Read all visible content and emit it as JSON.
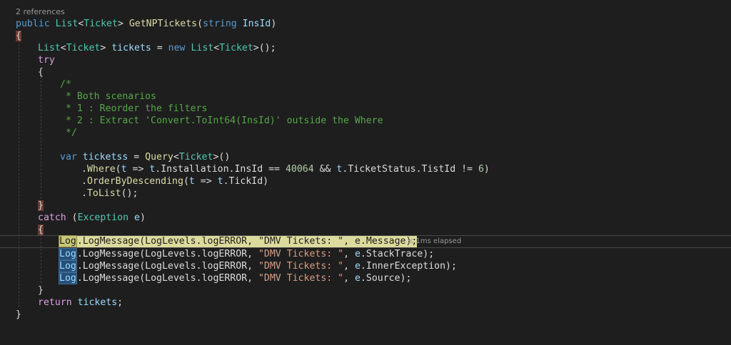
{
  "codelens": "2 references",
  "elapsed": "≤ 1ms elapsed",
  "lines": {
    "sig": {
      "kw1": "public ",
      "ty1": "List",
      "p1": "<",
      "ty2": "Ticket",
      "p2": "> ",
      "fn": "GetNPTickets",
      "p3": "(",
      "kw2": "string",
      "p4": " ",
      "id": "InsId",
      "p5": ")"
    },
    "open1": "{",
    "l3": {
      "ty1": "List",
      "p1": "<",
      "ty2": "Ticket",
      "p2": "> ",
      "id1": "tickets",
      "p3": " = ",
      "kw": "new",
      "p4": " ",
      "ty3": "List",
      "p5": "<",
      "ty4": "Ticket",
      "p6": ">();"
    },
    "try": "try",
    "open2": "{",
    "c1": "/*",
    "c2": " * Both scenarios",
    "c3": " * 1 : Reorder the filters",
    "c4": " * 2 : Extract 'Convert.ToInt64(InsId)' outside the Where",
    "c5": " */",
    "l11": {
      "kw": "var",
      "p1": " ",
      "id": "ticketss",
      "p2": " = ",
      "fn": "Query",
      "p3": "<",
      "ty": "Ticket",
      "p4": ">()"
    },
    "l12": {
      "p1": ".",
      "fn": "Where",
      "p2": "(",
      "id1": "t",
      "p3": " => ",
      "id2": "t",
      "p4": ".",
      "id3": "Installation",
      "p5": ".",
      "id4": "InsId",
      "p6": " == ",
      "num1": "40064",
      "p7": " && ",
      "id5": "t",
      "p8": ".",
      "id6": "TicketStatus",
      "p9": ".",
      "id7": "TistId",
      "p10": " != ",
      "num2": "6",
      "p11": ")"
    },
    "l13": {
      "p1": ".",
      "fn": "OrderByDescending",
      "p2": "(",
      "id1": "t",
      "p3": " => ",
      "id2": "t",
      "p4": ".",
      "id3": "TickId",
      "p5": ")"
    },
    "l14": {
      "p1": ".",
      "fn": "ToList",
      "p2": "();"
    },
    "close2": "}",
    "catch": {
      "ctl": "catch",
      "p1": " (",
      "ty": "Exception",
      "p2": " ",
      "id": "e",
      "p3": ")"
    },
    "open3": "{",
    "logs": [
      {
        "log": "Log",
        "p1": ".",
        "fn": "LogMessage",
        "p2": "(",
        "id1": "LogLevels",
        "p3": ".",
        "id2": "logERROR",
        "p4": ", ",
        "str": "\"DMV Tickets: \"",
        "p5": ", ",
        "id3": "e",
        "p6": ".",
        "id4": "Message",
        "p7": ");"
      },
      {
        "log": "Log",
        "p1": ".",
        "fn": "LogMessage",
        "p2": "(",
        "id1": "LogLevels",
        "p3": ".",
        "id2": "logERROR",
        "p4": ", ",
        "str": "\"DMV Tickets: \"",
        "p5": ", ",
        "id3": "e",
        "p6": ".",
        "id4": "StackTrace",
        "p7": ");"
      },
      {
        "log": "Log",
        "p1": ".",
        "fn": "LogMessage",
        "p2": "(",
        "id1": "LogLevels",
        "p3": ".",
        "id2": "logERROR",
        "p4": ", ",
        "str": "\"DMV Tickets: \"",
        "p5": ", ",
        "id3": "e",
        "p6": ".",
        "id4": "InnerException",
        "p7": ");"
      },
      {
        "log": "Log",
        "p1": ".",
        "fn": "LogMessage",
        "p2": "(",
        "id1": "LogLevels",
        "p3": ".",
        "id2": "logERROR",
        "p4": ", ",
        "str": "\"DMV Tickets: \"",
        "p5": ", ",
        "id3": "e",
        "p6": ".",
        "id4": "Source",
        "p7": ");"
      }
    ],
    "close3": "}",
    "ret": {
      "ctl": "return",
      "p1": " ",
      "id": "tickets",
      "p2": ";"
    },
    "close1": "}"
  },
  "colors": {
    "background": "#1e1e1e",
    "keyword": "#569cd6",
    "control": "#d8a0df",
    "type": "#4ec9b0",
    "method": "#dcdcaa",
    "identifier": "#9cdcfe",
    "string": "#d69d85",
    "number": "#b5cea8",
    "comment": "#57a64a",
    "current_statement": "#dcdb9d"
  }
}
